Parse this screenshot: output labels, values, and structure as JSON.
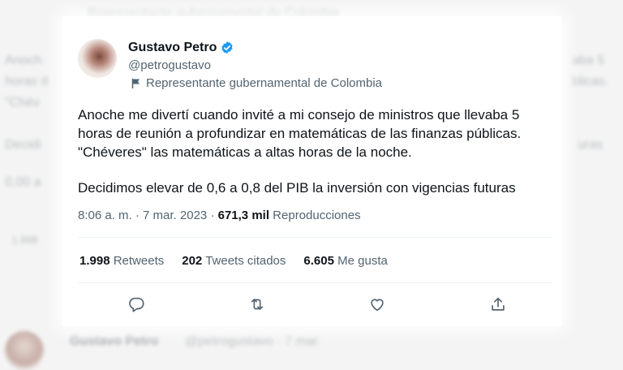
{
  "tweet": {
    "author_name": "Gustavo Petro",
    "author_handle": "@petrogustavo",
    "author_label": "Representante gubernamental de Colombia",
    "text_p1": "Anoche me divertí cuando invité a mi consejo de ministros que llevaba 5 horas de reunión a profundizar en matemáticas de las finanzas públicas. \"Chéveres\" las matemáticas a altas horas de la noche.",
    "text_p2": "Decidimos elevar de 0,6 a 0,8 del PIB la inversión con vigencias futuras",
    "time": "8:06 a. m.",
    "date": "7 mar. 2023",
    "views_count": "671,3 mil",
    "views_label": "Reproducciones",
    "retweets_count": "1.998",
    "retweets_label": "Retweets",
    "quotes_count": "202",
    "quotes_label": "Tweets citados",
    "likes_count": "6.605",
    "likes_label": "Me gusta"
  },
  "background": {
    "top_label": "Representante gubernamental de Colombia",
    "left_fragments": [
      "Anoch",
      "horas d",
      "\"Chév",
      "Decidi",
      "0,00 a",
      "1.998"
    ],
    "right_fragments": [
      "aba 5",
      "blicas.",
      "uras"
    ],
    "next_author": "Gustavo Petro",
    "next_handle": "@petrogustavo · 7 mar."
  },
  "icons": {
    "verified": "verified-badge-icon",
    "label": "government-flag-icon",
    "reply": "reply-icon",
    "retweet": "retweet-icon",
    "like": "heart-icon",
    "share": "share-icon"
  },
  "colors": {
    "verified": "#1d9bf0",
    "secondary_text": "#536471",
    "primary_text": "#0f1419"
  }
}
